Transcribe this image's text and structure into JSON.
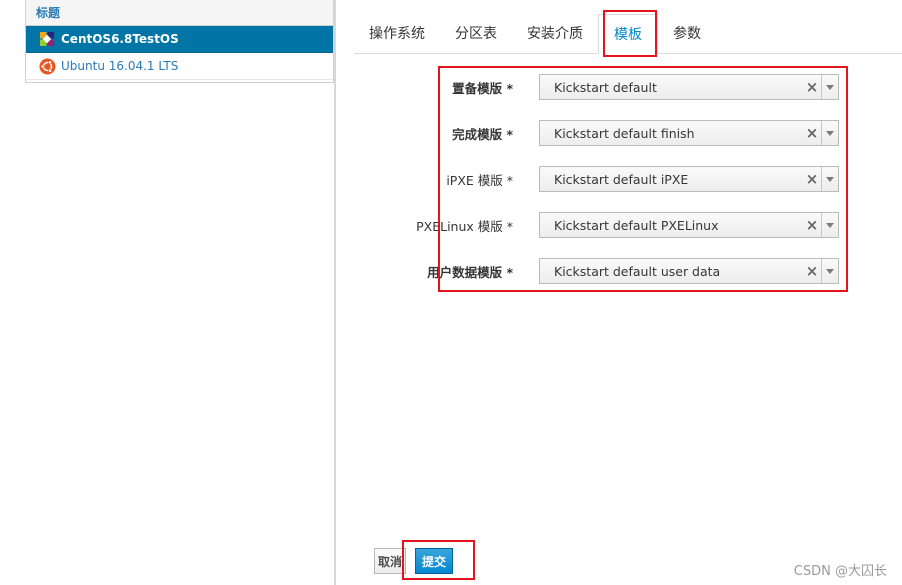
{
  "sidebar": {
    "header": "标题",
    "items": [
      {
        "label": "CentOS6.8TestOS",
        "icon": "centos-icon",
        "selected": true
      },
      {
        "label": "Ubuntu 16.04.1 LTS",
        "icon": "ubuntu-icon",
        "selected": false
      }
    ]
  },
  "tabs": [
    {
      "label": "操作系统"
    },
    {
      "label": "分区表"
    },
    {
      "label": "安装介质"
    },
    {
      "label": "模板",
      "active": true
    },
    {
      "label": "参数"
    }
  ],
  "form": {
    "rows": [
      {
        "label": "置备模版 *",
        "value": "Kickstart default"
      },
      {
        "label": "完成模版 *",
        "value": "Kickstart default finish"
      },
      {
        "label": "iPXE 模版 *",
        "value": "Kickstart default iPXE"
      },
      {
        "label": "PXELinux 模版 *",
        "value": "Kickstart default PXELinux"
      },
      {
        "label": "用户数据模版 *",
        "value": "Kickstart default user data"
      }
    ],
    "clear_symbol": "×"
  },
  "buttons": {
    "cancel": "取消",
    "submit": "提交"
  },
  "watermark": "CSDN @大囚长",
  "colors": {
    "selected_row": "#0176a6",
    "link": "#2b7bb9",
    "active_tab": "#0088ce",
    "primary_button": "#0088ce",
    "highlight_box": "#e4141f"
  }
}
